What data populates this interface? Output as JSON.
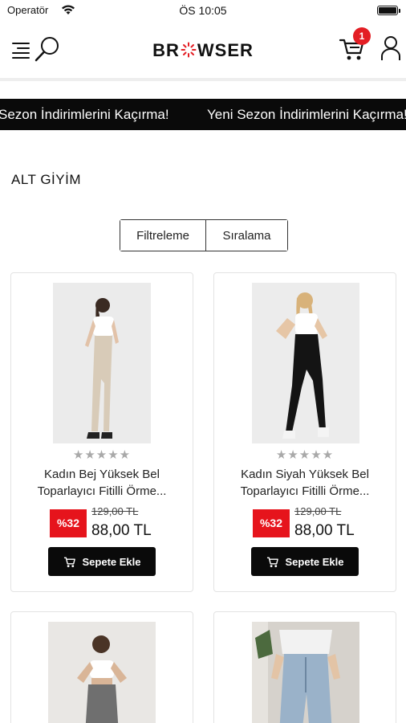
{
  "status_bar": {
    "carrier": "Operatör",
    "time": "ÖS 10:05"
  },
  "header": {
    "logo_text_before": "BR",
    "logo_text_after": "WSER",
    "cart_count": "1"
  },
  "marquee": {
    "items": [
      "Sezon İndirimlerini Kaçırma!",
      "Yeni Sezon İndirimlerini Kaçırma!"
    ]
  },
  "category": {
    "title": "ALT GİYİM"
  },
  "controls": {
    "filter_label": "Filtreleme",
    "sort_label": "Sıralama"
  },
  "products": [
    {
      "name": "Kadın Bej Yüksek Bel Toparlayıcı Fitilli Örme...",
      "rating_stars": 5,
      "discount": "%32",
      "old_price": "129,00 TL",
      "price": "88,00 TL",
      "cta": "Sepete Ekle",
      "image_colors": {
        "bg": "#ebebeb",
        "legging": "#d8cbb8"
      }
    },
    {
      "name": "Kadın Siyah Yüksek Bel Toparlayıcı Fitilli Örme...",
      "rating_stars": 5,
      "discount": "%32",
      "old_price": "129,00 TL",
      "price": "88,00 TL",
      "cta": "Sepete Ekle",
      "image_colors": {
        "bg": "#ececec",
        "legging": "#141414"
      }
    },
    {
      "image_colors": {
        "bg": "#e9e7e4",
        "legging": "#6f6f6f"
      }
    },
    {
      "image_colors": {
        "bg": "#d6d2cc",
        "legging": "#9ab2c9"
      }
    }
  ],
  "colors": {
    "accent_red": "#e31e24",
    "discount_red": "#e6141c",
    "bar_black": "#0a0a0a"
  }
}
